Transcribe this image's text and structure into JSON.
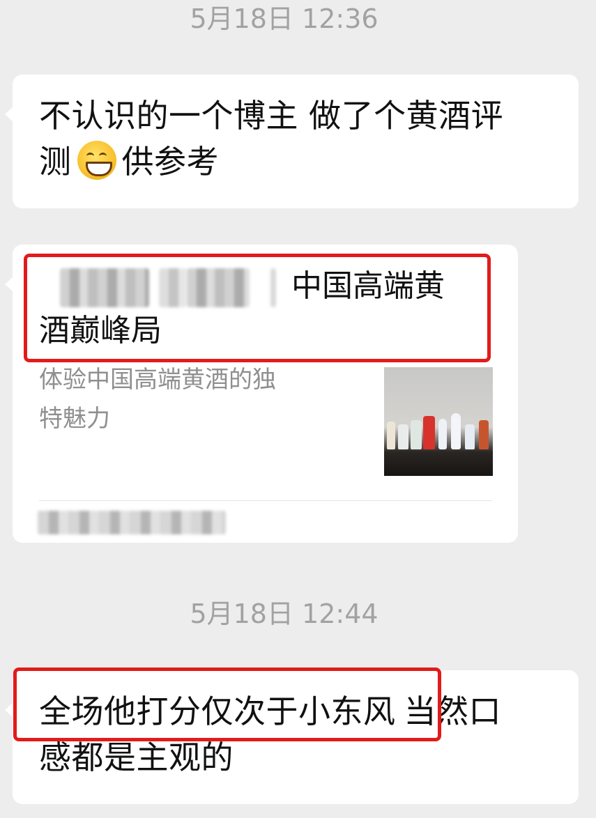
{
  "chat": {
    "messages": [
      {
        "time": "5月18日 12:36",
        "line1": "不认识的一个博主 做了个黄酒评",
        "line2_before": "测",
        "emoji": "grinning-face-emoji",
        "line2_after": "供参考"
      },
      {
        "card_title_line1": "中国高端黄",
        "card_title_line2": "酒巅峰局",
        "card_desc_line1": "体验中国高端黄酒的独",
        "card_desc_line2": "特魅力"
      },
      {
        "time": "5月18日 12:44",
        "line1": "全场他打分仅次于小东风",
        "line1_tail": "当然口",
        "line2": "感都是主观的"
      }
    ]
  },
  "colors": {
    "background": "#ededed",
    "bubble": "#ffffff",
    "highlight_box": "#e21b1b",
    "timestamp": "#a2a2a2"
  }
}
